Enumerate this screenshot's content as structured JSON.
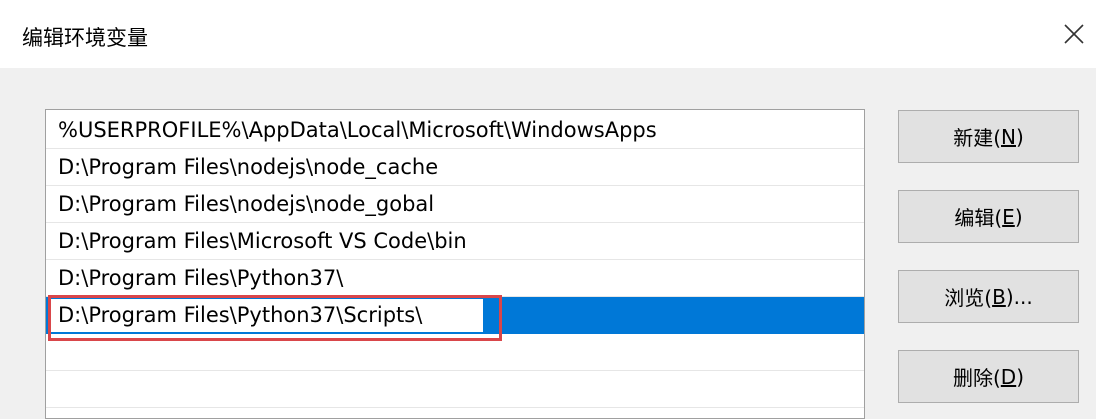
{
  "dialog": {
    "title": "编辑环境变量"
  },
  "path_list": {
    "items": [
      "%USERPROFILE%\\AppData\\Local\\Microsoft\\WindowsApps",
      "D:\\Program Files\\nodejs\\node_cache",
      "D:\\Program Files\\nodejs\\node_gobal",
      "D:\\Program Files\\Microsoft VS Code\\bin",
      "D:\\Program Files\\Python37\\"
    ],
    "editing_value": "D:\\Program Files\\Python37\\Scripts\\"
  },
  "buttons": {
    "new": {
      "label": "新建(",
      "key": "N",
      "suffix": ")"
    },
    "edit": {
      "label": "编辑(",
      "key": "E",
      "suffix": ")"
    },
    "browse": {
      "label": "浏览(",
      "key": "B",
      "suffix": ")..."
    },
    "delete": {
      "label": "删除(",
      "key": "D",
      "suffix": ")"
    }
  },
  "colors": {
    "selection": "#0078d7",
    "annotation": "#d9464a",
    "background": "#f0f0f0"
  },
  "icons": {
    "close": "close-icon"
  }
}
